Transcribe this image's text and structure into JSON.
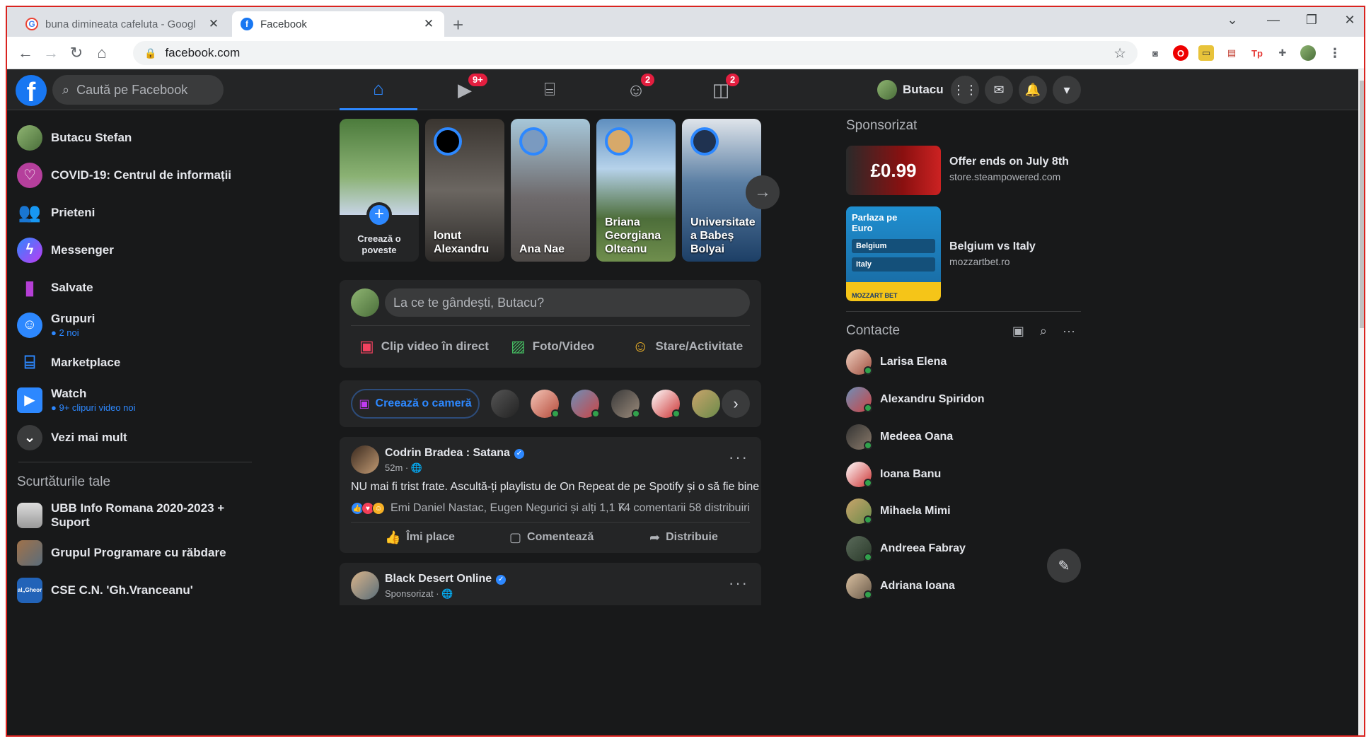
{
  "browser": {
    "tabs": [
      {
        "title": "buna dimineata cafeluta - Googl",
        "active": false
      },
      {
        "title": "Facebook",
        "active": true
      }
    ],
    "new_tab": "+",
    "url": "facebook.com",
    "window_controls": [
      "—",
      "❐",
      "✕"
    ]
  },
  "header": {
    "logo": "f",
    "search_placeholder": "Caută pe Facebook",
    "nav_badges": {
      "watch": "9+",
      "groups": "2",
      "gaming": "2"
    },
    "profile_name": "Butacu"
  },
  "left_nav": {
    "items": [
      {
        "label": "Butacu Stefan",
        "icon": "avatar"
      },
      {
        "label": "COVID-19: Centrul de informații",
        "icon": "heart-icon"
      },
      {
        "label": "Prieteni",
        "icon": "friends-icon"
      },
      {
        "label": "Messenger",
        "icon": "messenger-icon"
      },
      {
        "label": "Salvate",
        "icon": "bookmark-icon"
      },
      {
        "label": "Grupuri",
        "icon": "groups-icon",
        "sub": "2 noi"
      },
      {
        "label": "Marketplace",
        "icon": "marketplace-icon"
      },
      {
        "label": "Watch",
        "icon": "watch-icon",
        "sub": "9+ clipuri video noi"
      },
      {
        "label": "Vezi mai mult",
        "icon": "chevron-down-icon"
      }
    ],
    "shortcuts_heading": "Scurtăturile tale",
    "shortcuts": [
      "UBB Info Romana 2020-2023 + Suport",
      "Grupul Programare cu răbdare",
      "CSE C.N. 'Gh.Vranceanu'"
    ],
    "shortcut_thumb_text": "al„Gheor"
  },
  "stories": {
    "create_label": "Creează o poveste",
    "items": [
      {
        "name": "Ionut Alexandru",
        "lines": [
          "Ionut",
          "Alexandru"
        ]
      },
      {
        "name": "Ana Nae",
        "lines": [
          "Ana Nae"
        ]
      },
      {
        "name": "Briana Georgiana Olteanu",
        "lines": [
          "Briana",
          "Georgiana",
          "Olteanu"
        ]
      },
      {
        "name": "Universitate a Babeș Bolyai",
        "lines": [
          "Universitate",
          "a Babeș",
          "Bolyai"
        ]
      }
    ]
  },
  "composer": {
    "placeholder": "La ce te gândești, Butacu?",
    "actions": [
      "Clip video în direct",
      "Foto/Video",
      "Stare/Activitate"
    ]
  },
  "rooms": {
    "create_label": "Creează o cameră"
  },
  "posts": [
    {
      "author": "Codrin Bradea : Satana",
      "time": "52m · 🌐",
      "text": "NU mai fi trist frate. Ascultă-ți playlistu de On Repeat de pe Spotify și o să fie bine",
      "reactions": "Emi Daniel Nastac, Eugen Negurici și alți 1,1 K",
      "stats": "74 comentarii   58 distribuiri",
      "actions": [
        "Îmi place",
        "Comentează",
        "Distribuie"
      ]
    },
    {
      "author": "Black Desert Online",
      "time": "Sponsorizat · 🌐"
    }
  ],
  "right_rail": {
    "sponsored_heading": "Sponsorizat",
    "ads": [
      {
        "title": "Offer ends on July 8th",
        "url": "store.steampowered.com",
        "img_text": "£0.99"
      },
      {
        "title": "Belgium vs Italy",
        "url": "mozzartbet.ro",
        "img_text": [
          "Parlaza pe",
          "Euro",
          "Belgium",
          "Italy",
          "MOZZART BET"
        ]
      }
    ],
    "contacts_heading": "Contacte",
    "contacts": [
      "Larisa Elena",
      "Alexandru Spiridon",
      "Medeea Oana",
      "Ioana Banu",
      "Mihaela Mimi",
      "Andreea Fabray",
      "Adriana Ioana"
    ]
  },
  "colors": {
    "fb_blue": "#1877f2",
    "accent": "#2d88ff",
    "bg": "#18191a",
    "surface": "#242526",
    "notif_red": "#e41e3f",
    "online_green": "#31a24c"
  }
}
